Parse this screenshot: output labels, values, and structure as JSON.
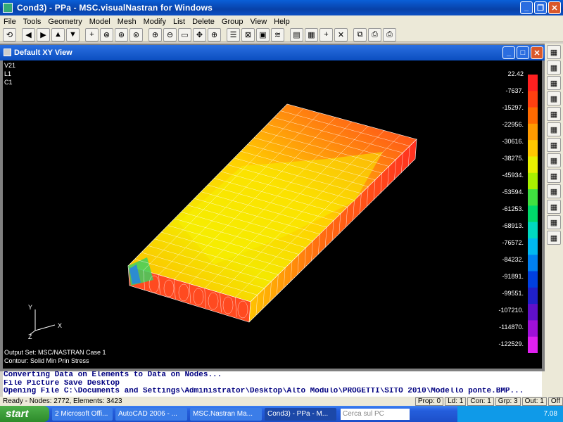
{
  "window": {
    "title": "Cond3) - PPa - MSC.visualNastran for Windows"
  },
  "menu": [
    "File",
    "Tools",
    "Geometry",
    "Model",
    "Mesh",
    "Modify",
    "List",
    "Delete",
    "Group",
    "View",
    "Help"
  ],
  "toolbar_icons": [
    "rotate-icon",
    "arrow-left-icon",
    "arrow-right-icon",
    "arrow-up-icon",
    "arrow-down-icon",
    "plus-icon",
    "rotate-x-icon",
    "rotate-y-icon",
    "rotate-z-icon",
    "zoom-in-icon",
    "zoom-out-icon",
    "zoom-box-icon",
    "pan-icon",
    "center-icon",
    "list-icon",
    "box-icon",
    "solid-icon",
    "layers-icon",
    "window-icon",
    "grid-icon",
    "crosshair-icon",
    "x-icon",
    "copy-icon",
    "print-preview-icon",
    "print-icon"
  ],
  "toolbar_glyphs": [
    "⟲",
    "◀",
    "▶",
    "▲",
    "▼",
    "+",
    "⊗",
    "⊛",
    "⊚",
    "⊕",
    "⊖",
    "▭",
    "✥",
    "⊕",
    "☰",
    "⊠",
    "▣",
    "≋",
    "▤",
    "▦",
    "+",
    "✕",
    "⧉",
    "⎙",
    "⎙"
  ],
  "view": {
    "title": "Default XY View",
    "labels": [
      "V21",
      "L1",
      "C1"
    ],
    "output_set": "Output Set: MSC/NASTRAN Case 1",
    "contour": "Contour: Solid Min Prin Stress",
    "axes": {
      "y": "Y",
      "x": "X",
      "z": "Z"
    }
  },
  "legend": {
    "values": [
      "22.42",
      "-7637.",
      "-15297.",
      "-22956.",
      "-30616.",
      "-38275.",
      "-45934.",
      "-53594.",
      "-61253.",
      "-68913.",
      "-76572.",
      "-84232.",
      "-91891.",
      "-99551.",
      "-107210.",
      "-114870.",
      "-122529."
    ],
    "colors": [
      "#ff2020",
      "#ff4010",
      "#ff6a00",
      "#ff9a00",
      "#ffc800",
      "#e8f000",
      "#a8f000",
      "#40e040",
      "#00d86a",
      "#00d8c0",
      "#00b8f0",
      "#0080f0",
      "#0040e0",
      "#2020c8",
      "#6010c8",
      "#a010d8",
      "#e020f0"
    ]
  },
  "right_toolbar_icons": [
    "view-icon",
    "mesh-up-icon",
    "mesh-down-icon",
    "grid-icon",
    "curve-icon",
    "plane-icon",
    "solid-icon",
    "element-icon",
    "node-icon",
    "group-icon",
    "surface-icon",
    "load-icon",
    "constraint-icon"
  ],
  "messages": [
    "Converting Data on Elements to Data on Nodes...",
    "File Picture Save Desktop",
    "Opening File C:\\Documents and Settings\\Administrator\\Desktop\\Alto Modulo\\PROGETTI\\SITO 2010\\Modello ponte.BMP..."
  ],
  "status": {
    "left": "Ready - Nodes: 2772,  Elements: 3423",
    "cells": [
      "Prop: 0",
      "Ld: 1",
      "Con: 1",
      "Grp: 3",
      "Out: 1",
      "Off"
    ]
  },
  "taskbar": {
    "start": "start",
    "items": [
      "2 Microsoft Offi...",
      "AutoCAD 2006 - ...",
      "MSC.Nastran Ma...",
      "Cond3) - PPa - M..."
    ],
    "search_placeholder": "Cerca sul PC",
    "clock": "7.08"
  }
}
